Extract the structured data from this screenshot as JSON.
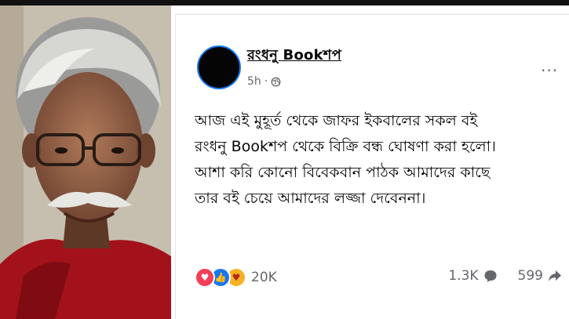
{
  "post": {
    "page_name": "রংধনু Bookশপ",
    "time": "5h",
    "separator": "·",
    "audience_icon": "globe-icon",
    "more_label": "···",
    "text": "আজ এই মুহূর্ত থেকে জাফর ইকবালের সকল বই\nরংধনু Bookশপ থেকে বিক্রি বন্ধ ঘোষণা করা হলো।\nআশা করি কোনো বিবেকবান পাঠক আমাদের কাছে\nতার বই চেয়ে আমাদের লজ্জা দেবেননা।"
  },
  "engagement": {
    "reactions": [
      "love-icon",
      "like-icon",
      "care-icon"
    ],
    "reaction_count": "20K",
    "comments": "1.3K",
    "shares": "599"
  },
  "colors": {
    "accent": "#1877f2",
    "text": "#050505",
    "muted": "#65676b"
  }
}
